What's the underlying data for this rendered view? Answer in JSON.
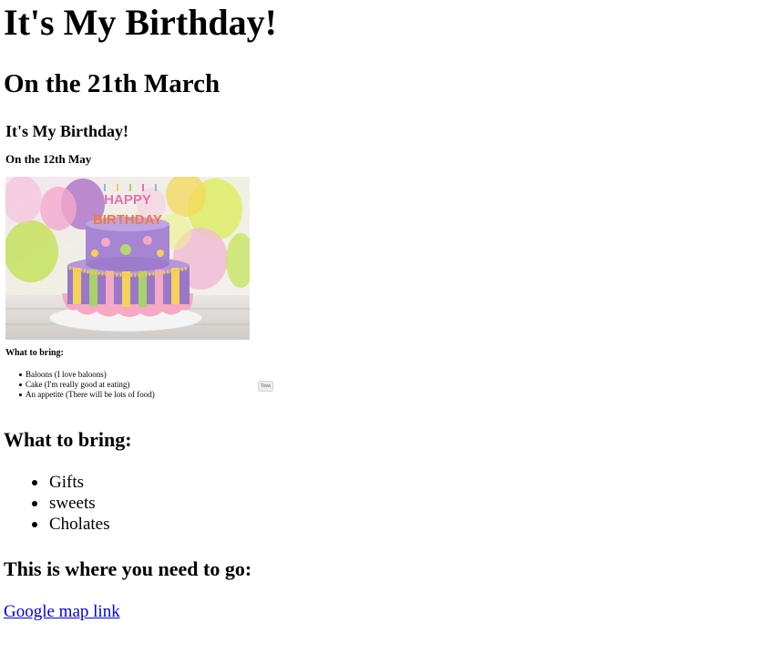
{
  "page": {
    "title": "It's My Birthday!",
    "date_heading": "On the 21th March",
    "bring_heading": "What to bring:",
    "bring_items": [
      "Gifts",
      "sweets",
      "Cholates"
    ],
    "location_heading": "This is where you need to go:",
    "map_link_text": "Google map link"
  },
  "embedded_screenshot": {
    "title": "It's My Birthday!",
    "date_heading": "On the 12th May",
    "cake_topper_text": "HAPPY BIRTHDAY",
    "bring_heading": "What to bring:",
    "bring_items": [
      "Baloons (I love baloons)",
      "Cake (I'm really good at eating)",
      "An appetite (There will be lots of food)"
    ],
    "button_label": "Tova"
  },
  "colors": {
    "text": "#000000",
    "link": "#0000ee",
    "background": "#ffffff"
  }
}
